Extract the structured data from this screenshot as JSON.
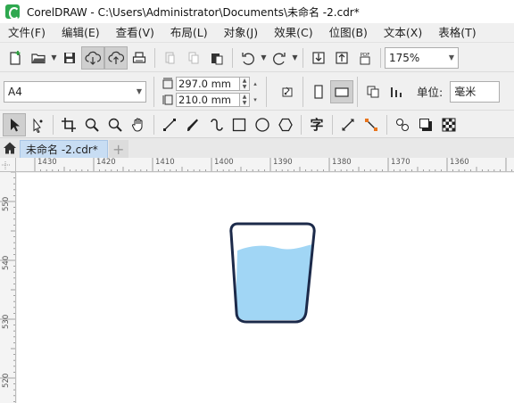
{
  "window": {
    "title": "CorelDRAW - C:\\Users\\Administrator\\Documents\\未命名 -2.cdr*"
  },
  "menu": [
    "文件(F)",
    "编辑(E)",
    "查看(V)",
    "布局(L)",
    "对象(J)",
    "效果(C)",
    "位图(B)",
    "文本(X)",
    "表格(T)"
  ],
  "toolbar": {
    "zoom_value": "175%",
    "pdf_label": "PDF"
  },
  "property_bar": {
    "page_size": "A4",
    "width": "297.0 mm",
    "height": "210.0 mm",
    "units_label": "单位:",
    "units_value": "毫米"
  },
  "toolbox": {
    "text_tool_glyph": "字"
  },
  "tabs": {
    "active": "未命名 -2.cdr*",
    "add_glyph": "+"
  },
  "rulers": {
    "horizontal": [
      "1430",
      "1420",
      "1410",
      "1400",
      "1390",
      "1380",
      "1370",
      "1360"
    ],
    "vertical": [
      "550",
      "540",
      "530",
      "520"
    ]
  },
  "colors": {
    "water": "#a1d6f5",
    "glass_outline": "#1c2a4a",
    "tab_active": "#c8ddf3"
  }
}
